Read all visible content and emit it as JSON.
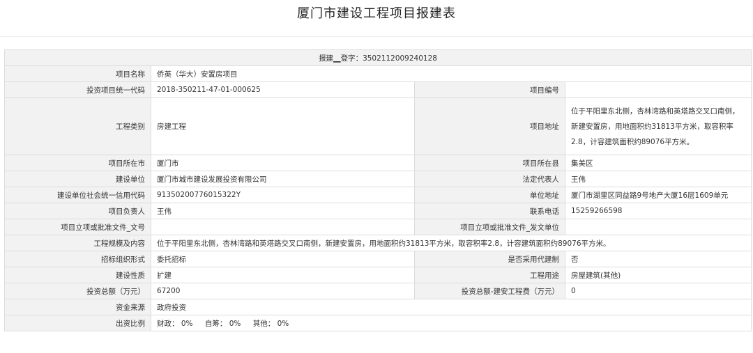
{
  "page_title": "厦门市建设工程项目报建表",
  "header": {
    "prefix": "报建",
    "blank": "__",
    "label": "登字",
    "colon": "：",
    "number": "3502112009240128"
  },
  "rows": {
    "project_name": {
      "label": "项目名称",
      "value": "侨英（华大）安置房项目"
    },
    "investment_code": {
      "label": "投资项目统一代码",
      "value": "2018-350211-47-01-000625"
    },
    "project_number": {
      "label": "项目编号",
      "value": ""
    },
    "engineering_category": {
      "label": "工程类别",
      "value": "房建工程"
    },
    "project_address": {
      "label": "项目地址",
      "value": "位于平阳里东北侧，杏林湾路和英塔路交叉口南侧，新建安置房，用地面积约31813平方米，取容积率2.8，计容建筑面积约89076平方米。"
    },
    "city": {
      "label": "项目所在市",
      "value": "厦门市"
    },
    "county": {
      "label": "项目所在县",
      "value": "集美区"
    },
    "construction_unit": {
      "label": "建设单位",
      "value": "厦门市城市建设发展投资有限公司"
    },
    "legal_rep": {
      "label": "法定代表人",
      "value": "王伟"
    },
    "credit_code": {
      "label": "建设单位社会统一信用代码",
      "value": "91350200776015322Y"
    },
    "unit_address": {
      "label": "单位地址",
      "value": "厦门市湖里区同益路9号地产大厦16层1609单元"
    },
    "project_lead": {
      "label": "项目负责人",
      "value": "王伟"
    },
    "phone": {
      "label": "联系电话",
      "value": "15259266598"
    },
    "approval_doc_no": {
      "label": "项目立项或批准文件_文号",
      "value": ""
    },
    "approval_issuer": {
      "label": "项目立项或批准文件_发文单位",
      "value": ""
    },
    "scale_content": {
      "label": "工程规模及内容",
      "value": "位于平阳里东北侧，杏林湾路和英塔路交叉口南侧，新建安置房，用地面积约31813平方米，取容积率2.8，计容建筑面积约89076平方米。"
    },
    "bidding_form": {
      "label": "招标组织形式",
      "value": "委托招标"
    },
    "agent_construction": {
      "label": "是否采用代建制",
      "value": "否"
    },
    "construction_nature": {
      "label": "建设性质",
      "value": "扩建"
    },
    "engineering_use": {
      "label": "工程用途",
      "value": "房屋建筑(其他)"
    },
    "total_investment": {
      "label": "投资总额（万元）",
      "value": "67200"
    },
    "installation_cost": {
      "label": "投资总额-建安工程费（万元）",
      "value": "0"
    },
    "fund_source": {
      "label": "资金来源",
      "value": "政府投资"
    },
    "contribution": {
      "label": "出资比例",
      "finance_label": "财政：",
      "finance_value": "0%",
      "self_label": "自筹：",
      "self_value": "0%",
      "other_label": "其他：",
      "other_value": "0%"
    }
  }
}
